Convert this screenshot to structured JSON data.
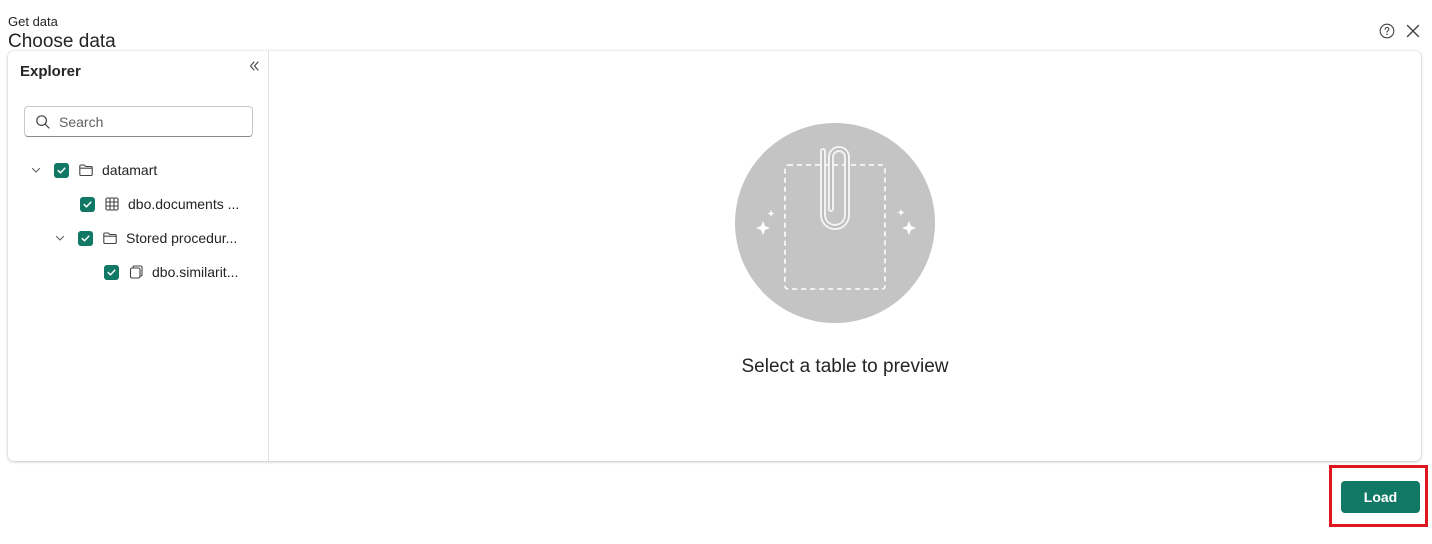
{
  "header": {
    "eyebrow": "Get data",
    "title": "Choose data"
  },
  "explorer": {
    "title": "Explorer",
    "search_placeholder": "Search",
    "tree": {
      "datamart": "datamart",
      "documents": "dbo.documents ...",
      "stored_procedures": "Stored procedur...",
      "similarity": "dbo.similarit..."
    }
  },
  "preview": {
    "message": "Select a table to preview"
  },
  "footer": {
    "load_label": "Load"
  },
  "colors": {
    "accent": "#117865",
    "highlight": "#e0161d"
  }
}
